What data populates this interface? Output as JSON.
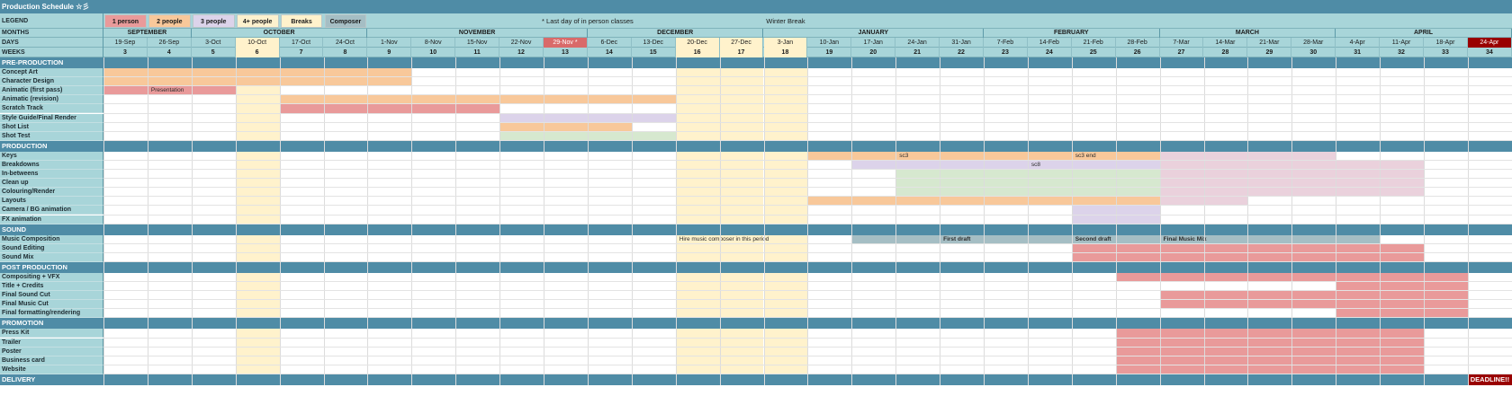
{
  "title": "Production Schedule ☆彡",
  "header_labels": {
    "legend": "LEGEND",
    "months": "MONTHS",
    "days": "DAYS",
    "weeks": "WEEKS"
  },
  "legend": [
    {
      "label": "1 person",
      "color": "#e99a9a"
    },
    {
      "label": "2 people",
      "color": "#f8c89a"
    },
    {
      "label": "3 people",
      "color": "#dcd3ea"
    },
    {
      "label": "4+ people",
      "color": "#fdf1ce"
    },
    {
      "label": "Breaks",
      "color": "#fff2cc"
    },
    {
      "label": "Composer",
      "color": "#a5bec4"
    }
  ],
  "notes": {
    "last_day": "* Last day of in person classes",
    "winter_break": "Winter Break"
  },
  "months": [
    {
      "name": "SEPTEMBER",
      "span": 2
    },
    {
      "name": "OCTOBER",
      "span": 4
    },
    {
      "name": "NOVEMBER",
      "span": 5
    },
    {
      "name": "DECEMBER",
      "span": 4
    },
    {
      "name": "JANUARY",
      "span": 5
    },
    {
      "name": "FEBRUARY",
      "span": 4
    },
    {
      "name": "MARCH",
      "span": 4
    },
    {
      "name": "APRIL",
      "span": 4
    }
  ],
  "days": [
    "19-Sep",
    "26-Sep",
    "3-Oct",
    "10-Oct",
    "17-Oct",
    "24-Oct",
    "1-Nov",
    "8-Nov",
    "15-Nov",
    "22-Nov",
    "29-Nov *",
    "6-Dec",
    "13-Dec",
    "20-Dec",
    "27-Dec",
    "3-Jan",
    "10-Jan",
    "17-Jan",
    "24-Jan",
    "31-Jan",
    "7-Feb",
    "14-Feb",
    "21-Feb",
    "28-Feb",
    "7-Mar",
    "14-Mar",
    "21-Mar",
    "28-Mar",
    "4-Apr",
    "11-Apr",
    "18-Apr",
    "24-Apr"
  ],
  "weeks": [
    "3",
    "4",
    "5",
    "6",
    "7",
    "8",
    "9",
    "10",
    "11",
    "12",
    "13",
    "14",
    "15",
    "16",
    "17",
    "18",
    "19",
    "20",
    "21",
    "22",
    "23",
    "24",
    "25",
    "26",
    "27",
    "28",
    "29",
    "30",
    "31",
    "32",
    "33",
    "34"
  ],
  "highlight_cols": {
    "break_cols": [
      3,
      13,
      14,
      15
    ],
    "red_day": 10,
    "deadline_day": 31
  },
  "sections": [
    {
      "title": "PRE-PRODUCTION",
      "rows": [
        {
          "name": "Concept Art",
          "bars": [
            {
              "start": 0,
              "end": 7,
              "color": "#f8c89a"
            }
          ]
        },
        {
          "name": "Character Design",
          "bars": [
            {
              "start": 0,
              "end": 7,
              "color": "#f8c89a"
            }
          ]
        },
        {
          "name": "Animatic (first pass)",
          "bars": [
            {
              "start": 0,
              "end": 3,
              "color": "#e99a9a"
            }
          ],
          "notes": [
            {
              "col": 1,
              "text": "Presentation"
            }
          ]
        },
        {
          "name": "Animatic (revision)",
          "bars": [
            {
              "start": 4,
              "end": 13,
              "color": "#f8c89a"
            }
          ]
        },
        {
          "name": "Scratch Track",
          "bars": [
            {
              "start": 4,
              "end": 9,
              "color": "#e99a9a"
            }
          ]
        },
        {
          "name": "Style Guide/Final Render",
          "bars": [
            {
              "start": 9,
              "end": 13,
              "color": "#dcd3ea"
            }
          ]
        },
        {
          "name": "Shot List",
          "bars": [
            {
              "start": 9,
              "end": 12,
              "color": "#f8c89a"
            }
          ]
        },
        {
          "name": "Shot Test",
          "bars": [
            {
              "start": 9,
              "end": 13,
              "color": "#d6e8cf"
            }
          ]
        }
      ]
    },
    {
      "title": "PRODUCTION",
      "rows": [
        {
          "name": "Keys",
          "bars": [
            {
              "start": 16,
              "end": 24,
              "color": "#f8c89a"
            },
            {
              "start": 24,
              "end": 28,
              "color": "#ead1dc"
            }
          ],
          "notes": [
            {
              "col": 18,
              "text": "sc3"
            },
            {
              "col": 22,
              "text": "sc3 end"
            }
          ]
        },
        {
          "name": "Breakdowns",
          "bars": [
            {
              "start": 17,
              "end": 24,
              "color": "#dcd3ea"
            },
            {
              "start": 24,
              "end": 30,
              "color": "#ead1dc"
            }
          ],
          "notes": [
            {
              "col": 21,
              "text": "sc8"
            }
          ]
        },
        {
          "name": "In-betweens",
          "bars": [
            {
              "start": 18,
              "end": 24,
              "color": "#d6e8cf"
            },
            {
              "start": 24,
              "end": 30,
              "color": "#ead1dc"
            }
          ]
        },
        {
          "name": "Clean up",
          "bars": [
            {
              "start": 18,
              "end": 24,
              "color": "#d6e8cf"
            },
            {
              "start": 24,
              "end": 30,
              "color": "#ead1dc"
            }
          ]
        },
        {
          "name": "Colouring/Render",
          "bars": [
            {
              "start": 18,
              "end": 24,
              "color": "#d6e8cf"
            },
            {
              "start": 24,
              "end": 30,
              "color": "#ead1dc"
            }
          ]
        },
        {
          "name": "Layouts",
          "bars": [
            {
              "start": 16,
              "end": 24,
              "color": "#f8c89a"
            },
            {
              "start": 24,
              "end": 26,
              "color": "#ead1dc"
            }
          ]
        },
        {
          "name": "Camera / BG  animation",
          "bars": [
            {
              "start": 22,
              "end": 24,
              "color": "#dcd3ea"
            }
          ]
        },
        {
          "name": "FX animation",
          "bars": [
            {
              "start": 22,
              "end": 24,
              "color": "#dcd3ea"
            }
          ]
        }
      ]
    },
    {
      "title": "SOUND",
      "rows": [
        {
          "name": "Music Composition",
          "bars": [
            {
              "start": 17,
              "end": 29,
              "color": "#a5bec4"
            }
          ],
          "notes": [
            {
              "col": 13,
              "text": "Hire music composer in this period"
            },
            {
              "col": 19,
              "text": "First draft",
              "bold": true
            },
            {
              "col": 22,
              "text": "Second draft",
              "bold": true
            },
            {
              "col": 24,
              "text": "Final Music Mix",
              "bold": true
            }
          ]
        },
        {
          "name": "Sound Editing",
          "bars": [
            {
              "start": 22,
              "end": 30,
              "color": "#e99a9a"
            }
          ]
        },
        {
          "name": "Sound Mix",
          "bars": [
            {
              "start": 22,
              "end": 30,
              "color": "#e99a9a"
            }
          ]
        }
      ]
    },
    {
      "title": "POST PRODUCTION",
      "rows": [
        {
          "name": "Compositing + VFX",
          "bars": [
            {
              "start": 23,
              "end": 31,
              "color": "#e99a9a"
            }
          ]
        },
        {
          "name": "Title + Credits",
          "bars": [
            {
              "start": 28,
              "end": 31,
              "color": "#e99a9a"
            }
          ]
        },
        {
          "name": "Final Sound Cut",
          "bars": [
            {
              "start": 24,
              "end": 31,
              "color": "#e99a9a"
            }
          ]
        },
        {
          "name": "Final Music Cut",
          "bars": [
            {
              "start": 24,
              "end": 31,
              "color": "#e99a9a"
            }
          ]
        },
        {
          "name": "Final formatting/rendering",
          "bars": [
            {
              "start": 28,
              "end": 31,
              "color": "#e99a9a"
            }
          ]
        }
      ]
    },
    {
      "title": "PROMOTION",
      "rows": [
        {
          "name": "Press Kit",
          "bars": [
            {
              "start": 23,
              "end": 30,
              "color": "#e99a9a"
            }
          ]
        },
        {
          "name": "Trailer",
          "bars": [
            {
              "start": 23,
              "end": 30,
              "color": "#e99a9a"
            }
          ]
        },
        {
          "name": "Poster",
          "bars": [
            {
              "start": 23,
              "end": 30,
              "color": "#e99a9a"
            }
          ]
        },
        {
          "name": "Business card",
          "bars": [
            {
              "start": 23,
              "end": 30,
              "color": "#e99a9a"
            }
          ]
        },
        {
          "name": "Website",
          "bars": [
            {
              "start": 23,
              "end": 30,
              "color": "#e99a9a"
            }
          ]
        }
      ]
    },
    {
      "title": "DELIVERY",
      "rows": [],
      "deadline": "DEADLINE!!"
    }
  ],
  "colors": {
    "header_teal": "#a8d5d9",
    "section_bar": "#4f8ca6",
    "title_bar": "#4f8ca6",
    "red_day": "#d96a6a",
    "deadline": "#990000",
    "break_col": "#fff2cc"
  }
}
